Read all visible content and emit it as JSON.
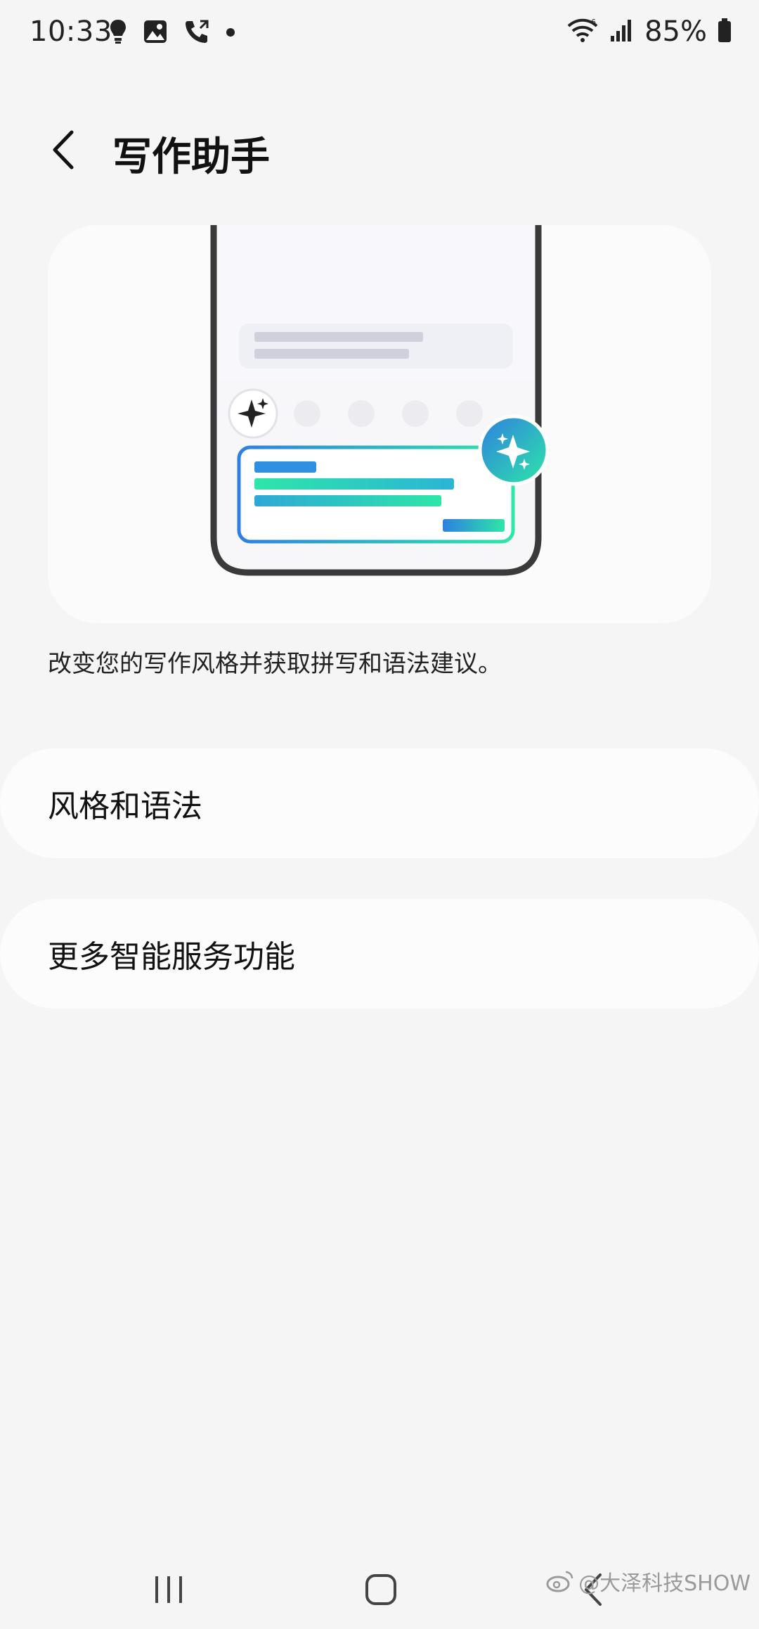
{
  "status_bar": {
    "time": "10:33",
    "battery_percent": "85%",
    "icons_left": [
      "bulb-icon",
      "gallery-icon",
      "phone-call-icon",
      "dot-icon"
    ],
    "icons_right": [
      "wifi-icon",
      "signal-icon",
      "battery-icon"
    ]
  },
  "header": {
    "title": "写作助手",
    "back_icon": "chevron-left-icon"
  },
  "illustration": {
    "icons": [
      "sparkle-icon",
      "ai-sparkle-badge-icon"
    ],
    "accent_blue": "#2f7fe0",
    "accent_green": "#2ee6a8"
  },
  "description": "改变您的写作风格并获取拼写和语法建议。",
  "menu": {
    "items": [
      {
        "label": "风格和语法"
      },
      {
        "label": "更多智能服务功能"
      }
    ]
  },
  "nav_bar": {
    "icons": [
      "recent-apps-icon",
      "home-icon",
      "back-icon"
    ]
  },
  "watermark": {
    "text": "@大泽科技SHOW",
    "icon": "weibo-icon"
  }
}
